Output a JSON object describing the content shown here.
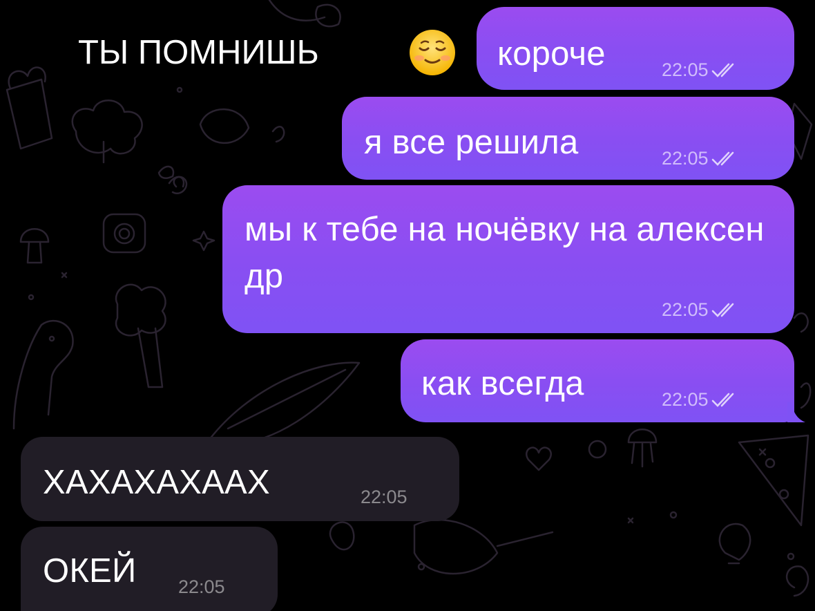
{
  "chat": {
    "header_text": "ТЫ ПОМНИШЬ",
    "header_emoji": "smiling-face-icon",
    "colors": {
      "outgoing_top": "#9b4cf0",
      "outgoing_bottom": "#7f52f4",
      "incoming": "#211d26",
      "background": "#000000"
    },
    "messages": [
      {
        "direction": "out",
        "text": "короче",
        "time": "22:05",
        "status": "double-check-icon"
      },
      {
        "direction": "out",
        "text": "я все решила",
        "time": "22:05",
        "status": "double-check-icon"
      },
      {
        "direction": "out",
        "text": "мы к тебе на ночёвку на алексен др",
        "time": "22:05",
        "status": "double-check-icon"
      },
      {
        "direction": "out",
        "text": "как всегда",
        "time": "22:05",
        "status": "double-check-icon"
      },
      {
        "direction": "in",
        "text": "ХАХАХАХААХ",
        "time": "22:05"
      },
      {
        "direction": "in",
        "text": "ОКЕЙ",
        "time": "22:05"
      }
    ]
  }
}
